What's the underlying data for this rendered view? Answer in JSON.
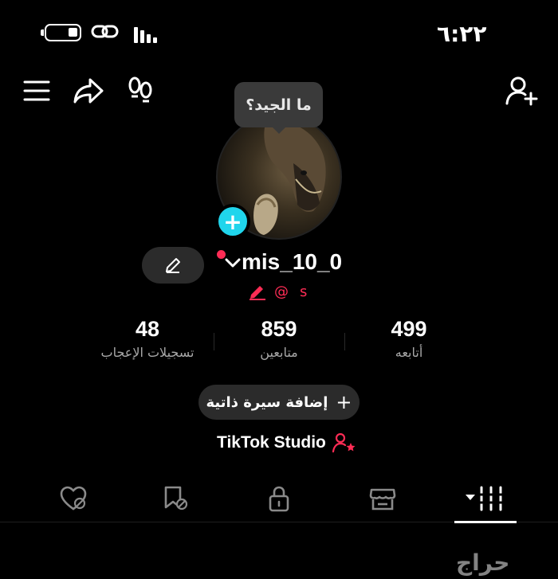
{
  "status_bar": {
    "time": "٦:٢٢"
  },
  "header": {
    "icons": [
      "menu-icon",
      "share-icon",
      "footprints-icon",
      "add-friend-icon"
    ]
  },
  "profile": {
    "tooltip": "ما الجيد؟",
    "username": "mis_10_0",
    "subline_text": "s",
    "subline_at": "@",
    "stats": {
      "likes": {
        "value": "48",
        "label": "تسجيلات الإعجاب"
      },
      "followers": {
        "value": "859",
        "label": "متابعين"
      },
      "following": {
        "value": "499",
        "label": "أتابعه"
      }
    },
    "add_bio_label": "إضافة سيرة ذاتية",
    "add_bio_plus": "+",
    "studio_label": "TikTok Studio"
  },
  "tabs": [
    "liked-icon",
    "favorites-icon",
    "private-lock-icon",
    "shop-icon",
    "videos-grid-icon"
  ],
  "accent_colors": {
    "cyan": "#20d5ec",
    "red": "#fe2c55"
  },
  "watermark": "حراج"
}
